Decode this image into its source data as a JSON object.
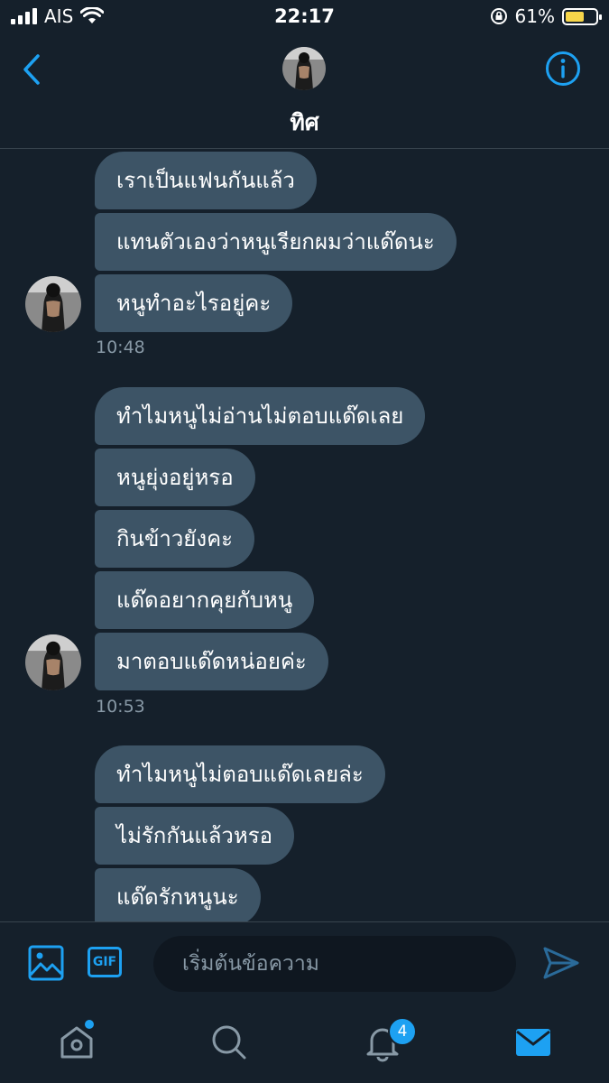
{
  "status_bar": {
    "carrier": "AIS",
    "time": "22:17",
    "battery": "61%",
    "battery_level": 0.61
  },
  "header": {
    "contact_name": "ทิศ"
  },
  "messages": [
    {
      "text": "เราเป็นแฟนกันแล้ว"
    },
    {
      "text": "แทนตัวเองว่าหนูเรียกผมว่าแด๊ดนะ"
    },
    {
      "text": "หนูทำอะไรอยู่คะ"
    },
    {
      "text": "ทำไมหนูไม่อ่านไม่ตอบแด๊ดเลย"
    },
    {
      "text": "หนูยุ่งอยู่หรอ"
    },
    {
      "text": "กินข้าวยังคะ"
    },
    {
      "text": "แด๊ดอยากคุยกับหนู"
    },
    {
      "text": "มาตอบแด๊ดหน่อยค่ะ"
    },
    {
      "text": "ทำไมหนูไม่ตอบแด๊ดเลยล่ะ"
    },
    {
      "text": "ไม่รักกันแล้วหรอ"
    },
    {
      "text": "แด๊ดรักหนูนะ"
    }
  ],
  "timestamps": [
    "10:48",
    "10:53"
  ],
  "composer": {
    "gif_label": "GIF",
    "placeholder": "เริ่มต้นข้อความ"
  },
  "tabbar": {
    "notifications_badge": "4"
  },
  "colors": {
    "background": "#15202b",
    "bubble": "#3d5466",
    "accent": "#1da1f2",
    "muted": "#8899a6"
  },
  "icons": [
    "back-arrow-icon",
    "info-icon",
    "media-icon",
    "gif-icon",
    "send-icon",
    "home-icon",
    "search-icon",
    "notifications-icon",
    "messages-icon"
  ]
}
